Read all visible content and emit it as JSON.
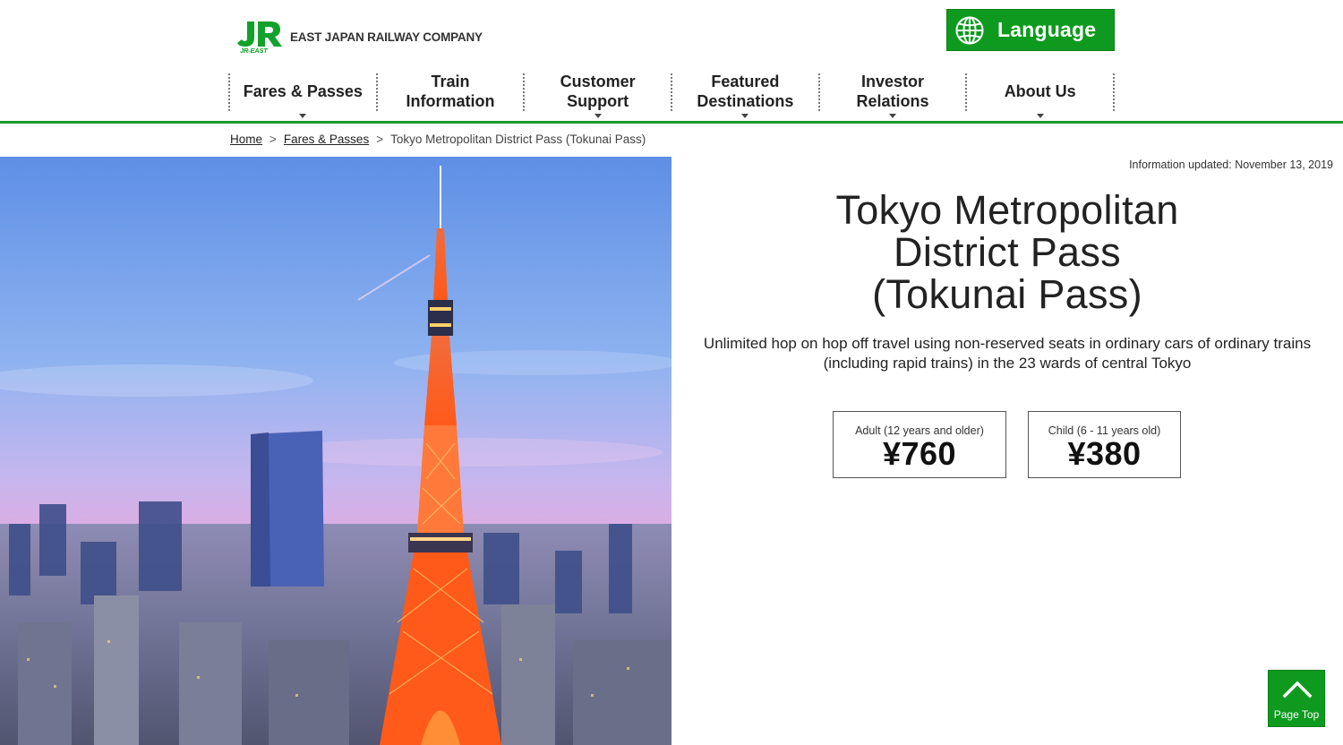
{
  "header": {
    "logo_mark": "JR",
    "logo_sub": "JR-EAST",
    "company_name": "EAST JAPAN RAILWAY COMPANY",
    "language_label": "Language",
    "language_icon": "globe-icon",
    "accent_color": "#0e9a1f"
  },
  "nav": {
    "items": [
      {
        "label": "Fares & Passes",
        "has_dropdown": true
      },
      {
        "label": "Train\nInformation",
        "has_dropdown": false
      },
      {
        "label": "Customer\nSupport",
        "has_dropdown": true
      },
      {
        "label": "Featured\nDestinations",
        "has_dropdown": true
      },
      {
        "label": "Investor\nRelations",
        "has_dropdown": true
      },
      {
        "label": "About Us",
        "has_dropdown": true
      }
    ]
  },
  "breadcrumb": {
    "home": "Home",
    "fares": "Fares & Passes",
    "separator": ">",
    "current": "Tokyo Metropolitan District Pass (Tokunai Pass)"
  },
  "main": {
    "updated": "Information updated: November 13, 2019",
    "title": "Tokyo Metropolitan\nDistrict Pass\n(Tokunai Pass)",
    "subtitle": "Unlimited hop on hop off travel using non-reserved seats in ordinary cars of ordinary trains (including rapid trains) in the 23 wards of central Tokyo",
    "prices": {
      "adult_label": "Adult (12 years and older)",
      "adult_value": "¥760",
      "child_label": "Child (6 - 11 years old)",
      "child_value": "¥380"
    }
  },
  "page_top": {
    "label": "Page Top",
    "icon": "chevron-up-icon"
  }
}
